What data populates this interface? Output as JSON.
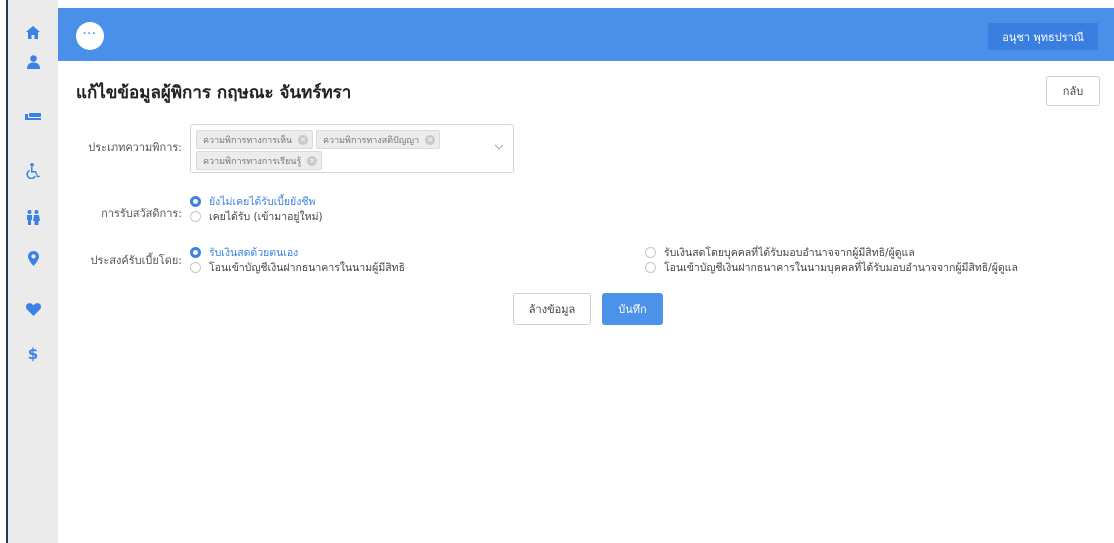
{
  "sidebar": {
    "items": [
      {
        "icon": "home-icon"
      },
      {
        "icon": "user-icon"
      },
      {
        "icon": "bed-icon"
      },
      {
        "icon": "wheelchair-icon"
      },
      {
        "icon": "family-icon"
      },
      {
        "icon": "location-pin-icon"
      },
      {
        "icon": "heart-icon"
      },
      {
        "icon": "dollar-icon"
      }
    ]
  },
  "topbar": {
    "more_label": "···",
    "user_name": "อนุชา พุทธปราณี"
  },
  "page": {
    "title": "แก้ไขข้อมูลผู้พิการ กฤษณะ จันทร์ทรา",
    "back_label": "กลับ"
  },
  "form": {
    "disability_type": {
      "label": "ประเภทความพิการ:",
      "tags": [
        "ความพิการทางการเห็น",
        "ความพิการทางสติปัญญา",
        "ความพิการทางการเรียนรู้"
      ]
    },
    "welfare": {
      "label": "การรับสวัสดิการ:",
      "options": [
        "ยังไม่เคยได้รับเบี้ยยังชีพ",
        "เคยได้รับ (เข้ามาอยู่ใหม่)"
      ],
      "selected": 0
    },
    "payment": {
      "label": "ประสงค์รับเบี้ยโดย:",
      "options": [
        "รับเงินสดด้วยตนเอง",
        "โอนเข้าบัญชีเงินฝากธนาคารในนามผู้มีสิทธิ",
        "รับเงินสดโดยบุคคลที่ได้รับมอบอำนาจจากผู้มีสิทธิ/ผู้ดูแล",
        "โอนเข้าบัญชีเงินฝากธนาคารในนามบุคคลที่ได้รับมอบอำนาจจากผู้มีสิทธิ/ผู้ดูแล"
      ],
      "selected": 0
    },
    "clear_label": "ล้างข้อมูล",
    "save_label": "บันทึก"
  },
  "colors": {
    "primary": "#4a90e8",
    "sidebar_bg": "#ebebeb",
    "sidebar_icon": "#3b82e6"
  }
}
